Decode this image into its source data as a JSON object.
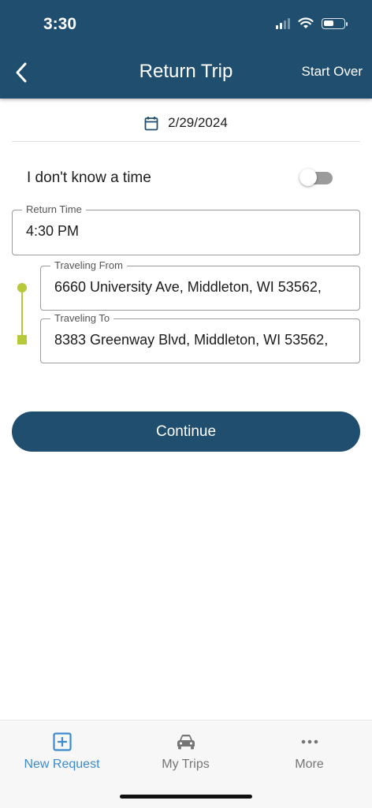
{
  "status_bar": {
    "time": "3:30",
    "battery_level": 0.5
  },
  "header": {
    "title": "Return Trip",
    "start_over_label": "Start Over",
    "color": "#1f4e6e"
  },
  "date": {
    "value": "2/29/2024"
  },
  "time_toggle": {
    "label": "I don't know a time",
    "on": false
  },
  "return_time": {
    "label": "Return Time",
    "value": "4:30 PM"
  },
  "traveling_from": {
    "label": "Traveling From",
    "value": "6660 University Ave, Middleton, WI 53562,"
  },
  "traveling_to": {
    "label": "Traveling To",
    "value": "8383 Greenway Blvd, Middleton, WI 53562,"
  },
  "route_color": "#b7c83a",
  "continue_label": "Continue",
  "tabs": [
    {
      "label": "New Request",
      "icon": "plus-square-icon",
      "active": true
    },
    {
      "label": "My Trips",
      "icon": "car-icon",
      "active": false
    },
    {
      "label": "More",
      "icon": "more-dots-icon",
      "active": false
    }
  ],
  "accent_color": "#3c8ad0"
}
